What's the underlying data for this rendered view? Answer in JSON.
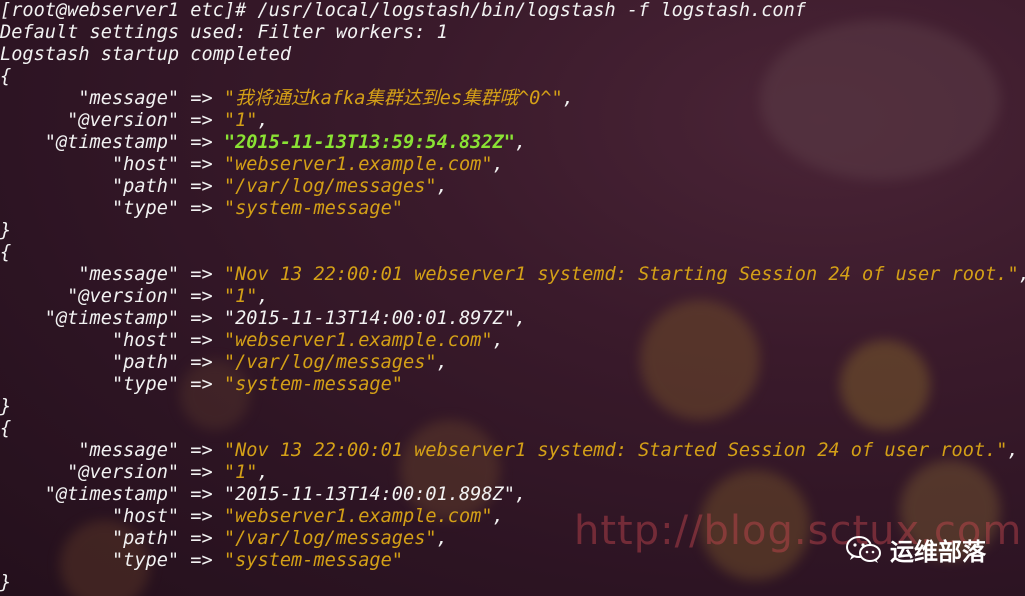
{
  "terminal": {
    "lines": [
      {
        "segments": [
          {
            "t": "[root@webserver1 etc]# /usr/local/logstash/bin/logstash -f logstash.conf",
            "c": "key"
          }
        ]
      },
      {
        "segments": [
          {
            "t": "Default settings used: Filter workers: 1",
            "c": "key"
          }
        ]
      },
      {
        "segments": [
          {
            "t": "Logstash startup completed",
            "c": "key"
          }
        ]
      },
      {
        "segments": [
          {
            "t": "{",
            "c": "punct"
          }
        ]
      },
      {
        "segments": [
          {
            "t": "       \"message\" => ",
            "c": "key"
          },
          {
            "t": "\"我将通过kafka集群达到es集群哦^0^\"",
            "c": "str"
          },
          {
            "t": ",",
            "c": "punct"
          }
        ]
      },
      {
        "segments": [
          {
            "t": "      \"@version\" => ",
            "c": "key"
          },
          {
            "t": "\"1\"",
            "c": "str"
          },
          {
            "t": ",",
            "c": "punct"
          }
        ]
      },
      {
        "segments": [
          {
            "t": "    \"@timestamp\" => ",
            "c": "key"
          },
          {
            "t": "\"2015-11-13T13:59:54.832Z\"",
            "c": "ts-bold"
          },
          {
            "t": ",",
            "c": "punct"
          }
        ]
      },
      {
        "segments": [
          {
            "t": "          \"host\" => ",
            "c": "key"
          },
          {
            "t": "\"webserver1.example.com\"",
            "c": "str"
          },
          {
            "t": ",",
            "c": "punct"
          }
        ]
      },
      {
        "segments": [
          {
            "t": "          \"path\" => ",
            "c": "key"
          },
          {
            "t": "\"/var/log/messages\"",
            "c": "str"
          },
          {
            "t": ",",
            "c": "punct"
          }
        ]
      },
      {
        "segments": [
          {
            "t": "          \"type\" => ",
            "c": "key"
          },
          {
            "t": "\"system-message\"",
            "c": "str"
          }
        ]
      },
      {
        "segments": [
          {
            "t": "}",
            "c": "punct"
          }
        ]
      },
      {
        "segments": [
          {
            "t": "{",
            "c": "punct"
          }
        ]
      },
      {
        "segments": [
          {
            "t": "       \"message\" => ",
            "c": "key"
          },
          {
            "t": "\"Nov 13 22:00:01 webserver1 systemd: Starting Session 24 of user root.\"",
            "c": "str"
          },
          {
            "t": ",",
            "c": "punct"
          }
        ]
      },
      {
        "segments": [
          {
            "t": "      \"@version\" => ",
            "c": "key"
          },
          {
            "t": "\"1\"",
            "c": "str"
          },
          {
            "t": ",",
            "c": "punct"
          }
        ]
      },
      {
        "segments": [
          {
            "t": "    \"@timestamp\" => ",
            "c": "key"
          },
          {
            "t": "\"2015-11-13T14:00:01.897Z\"",
            "c": "ts-plain"
          },
          {
            "t": ",",
            "c": "punct"
          }
        ]
      },
      {
        "segments": [
          {
            "t": "          \"host\" => ",
            "c": "key"
          },
          {
            "t": "\"webserver1.example.com\"",
            "c": "str"
          },
          {
            "t": ",",
            "c": "punct"
          }
        ]
      },
      {
        "segments": [
          {
            "t": "          \"path\" => ",
            "c": "key"
          },
          {
            "t": "\"/var/log/messages\"",
            "c": "str"
          },
          {
            "t": ",",
            "c": "punct"
          }
        ]
      },
      {
        "segments": [
          {
            "t": "          \"type\" => ",
            "c": "key"
          },
          {
            "t": "\"system-message\"",
            "c": "str"
          }
        ]
      },
      {
        "segments": [
          {
            "t": "}",
            "c": "punct"
          }
        ]
      },
      {
        "segments": [
          {
            "t": "{",
            "c": "punct"
          }
        ]
      },
      {
        "segments": [
          {
            "t": "       \"message\" => ",
            "c": "key"
          },
          {
            "t": "\"Nov 13 22:00:01 webserver1 systemd: Started Session 24 of user root.\"",
            "c": "str"
          },
          {
            "t": ",",
            "c": "punct"
          }
        ]
      },
      {
        "segments": [
          {
            "t": "      \"@version\" => ",
            "c": "key"
          },
          {
            "t": "\"1\"",
            "c": "str"
          },
          {
            "t": ",",
            "c": "punct"
          }
        ]
      },
      {
        "segments": [
          {
            "t": "    \"@timestamp\" => ",
            "c": "key"
          },
          {
            "t": "\"2015-11-13T14:00:01.898Z\"",
            "c": "ts-plain"
          },
          {
            "t": ",",
            "c": "punct"
          }
        ]
      },
      {
        "segments": [
          {
            "t": "          \"host\" => ",
            "c": "key"
          },
          {
            "t": "\"webserver1.example.com\"",
            "c": "str"
          },
          {
            "t": ",",
            "c": "punct"
          }
        ]
      },
      {
        "segments": [
          {
            "t": "          \"path\" => ",
            "c": "key"
          },
          {
            "t": "\"/var/log/messages\"",
            "c": "str"
          },
          {
            "t": ",",
            "c": "punct"
          }
        ]
      },
      {
        "segments": [
          {
            "t": "          \"type\" => ",
            "c": "key"
          },
          {
            "t": "\"system-message\"",
            "c": "str"
          }
        ]
      },
      {
        "segments": [
          {
            "t": "}",
            "c": "punct"
          }
        ]
      }
    ]
  },
  "watermark": {
    "url": "http://blog.sctux.com"
  },
  "brand": {
    "icon": "wechat-icon",
    "name": "运维部落"
  },
  "colors": {
    "text": "#f2f2f2",
    "string": "#d4a017",
    "timestamp_highlight": "#8ae234"
  }
}
